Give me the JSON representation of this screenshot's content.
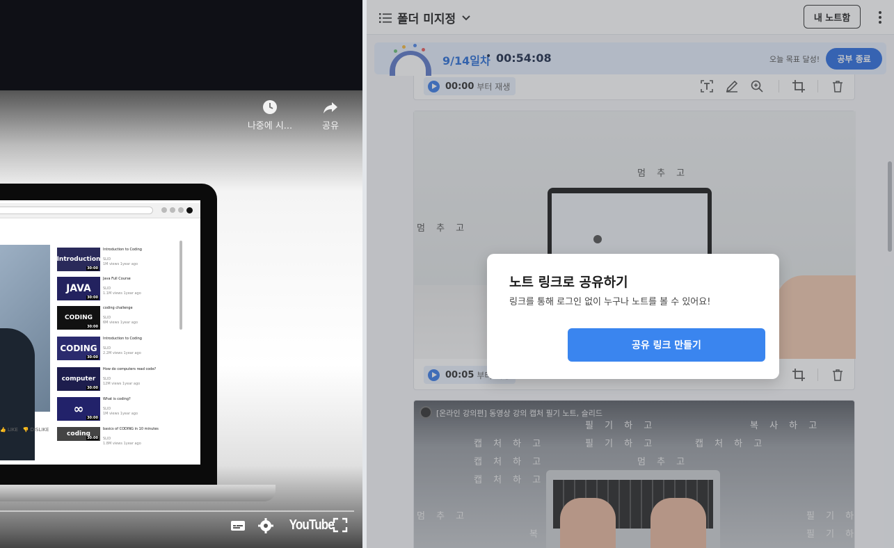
{
  "video": {
    "watch_later_label": "나중에 시...",
    "share_label": "공유",
    "youtube_logo": "YouTube",
    "subtitles_icon": "subtitles-icon",
    "settings_icon": "gear-icon",
    "fullscreen_icon": "fullscreen-icon",
    "laptop": {
      "likes": "LIKE",
      "dislikes": "DISLIKE",
      "related": [
        {
          "thumb": "Introduction",
          "title": "Introduction to Coding",
          "channel": "SLID",
          "meta": "1M views 1year ago",
          "duration": "30:00"
        },
        {
          "thumb": "JAVA",
          "title": "Java Full Course",
          "channel": "SLID",
          "meta": "1.1M views 1year ago",
          "duration": "30:00"
        },
        {
          "thumb": "CODING",
          "title": "coding challenge",
          "channel": "SLID",
          "meta": "6M views 1year ago",
          "duration": "30:00"
        },
        {
          "thumb": "CODING",
          "title": "Introduction to Coding",
          "channel": "SLID",
          "meta": "2.2M views 1year ago",
          "duration": "30:00"
        },
        {
          "thumb": "computer",
          "title": "How do computers read code?",
          "channel": "SLID",
          "meta": "12M views 1year ago",
          "duration": "30:00"
        },
        {
          "thumb": "∞",
          "title": "What is coding?",
          "channel": "SLID",
          "meta": "1M views 1year ago",
          "duration": "30:00"
        },
        {
          "thumb": "coding",
          "title": "basics of CODING in 10 minutes",
          "channel": "SLID",
          "meta": "1.8M views 1year ago",
          "duration": "30:00"
        }
      ]
    }
  },
  "header": {
    "folder_label": "폴더 미지정",
    "my_notes_button": "내 노트함"
  },
  "study_bar": {
    "day": "9/14일차",
    "separator": "•",
    "timer": "00:54:08",
    "goal_text": "오늘 목표 달성!",
    "end_button": "공부 종료"
  },
  "cards": [
    {
      "time": "00:00",
      "play_from": "부터 재생"
    },
    {
      "time": "00:05",
      "play_from": "부터 재생",
      "labels": [
        "멈 추 고",
        "멈 추 고"
      ]
    },
    {
      "caption": "[온라인 강의편] 동영상 강의 캡처 필기 노트, 슬리드",
      "labels": [
        "필 기 하 고",
        "복 사 하 고",
        "캡 처 하 고",
        "필 기 하 고",
        "캡 처 하 고",
        "캡 처 하 고",
        "멈 추 고",
        "캡 처 하 고",
        "멈 추 고",
        "필 기 하 고",
        "필 기 하 고",
        "복 사"
      ]
    }
  ],
  "modal": {
    "title": "노트 링크로 공유하기",
    "description": "링크를 통해 로그인 없이 누구나 노트를 볼 수 있어요!",
    "button": "공유 링크 만들기"
  },
  "colors": {
    "accent": "#3a85ef",
    "timer_blue": "#2c6fd8",
    "study_bar_bg": "#e5eefc",
    "overlay": "rgba(70,74,82,0.32)"
  }
}
